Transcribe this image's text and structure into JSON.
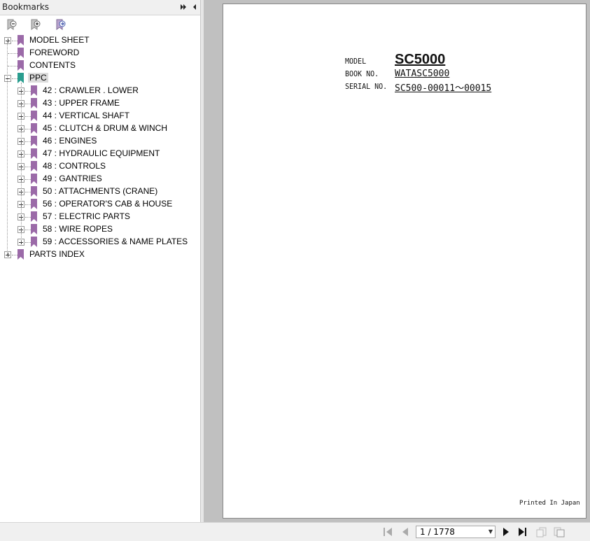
{
  "panel": {
    "title": "Bookmarks"
  },
  "tree": [
    {
      "label": "MODEL SHEET",
      "level": 0,
      "expander": "plus"
    },
    {
      "label": "FOREWORD",
      "level": 0,
      "expander": "none"
    },
    {
      "label": "CONTENTS",
      "level": 0,
      "expander": "none"
    },
    {
      "label": "PPC",
      "level": 0,
      "expander": "minus",
      "selected": true,
      "icon": "teal"
    },
    {
      "label": "42 : CRAWLER . LOWER",
      "level": 1,
      "expander": "plus"
    },
    {
      "label": "43 : UPPER FRAME",
      "level": 1,
      "expander": "plus"
    },
    {
      "label": "44 : VERTICAL SHAFT",
      "level": 1,
      "expander": "plus"
    },
    {
      "label": "45 : CLUTCH & DRUM & WINCH",
      "level": 1,
      "expander": "plus"
    },
    {
      "label": "46 : ENGINES",
      "level": 1,
      "expander": "plus"
    },
    {
      "label": "47 : HYDRAULIC EQUIPMENT",
      "level": 1,
      "expander": "plus"
    },
    {
      "label": "48 : CONTROLS",
      "level": 1,
      "expander": "plus"
    },
    {
      "label": "49 : GANTRIES",
      "level": 1,
      "expander": "plus"
    },
    {
      "label": "50 : ATTACHMENTS (CRANE)",
      "level": 1,
      "expander": "plus"
    },
    {
      "label": "56 : OPERATOR'S CAB & HOUSE",
      "level": 1,
      "expander": "plus"
    },
    {
      "label": "57 : ELECTRIC PARTS",
      "level": 1,
      "expander": "plus"
    },
    {
      "label": "58 : WIRE ROPES",
      "level": 1,
      "expander": "plus"
    },
    {
      "label": "59 : ACCESSORIES & NAME PLATES",
      "level": 1,
      "expander": "plus"
    },
    {
      "label": "PARTS INDEX",
      "level": 0,
      "expander": "plus"
    }
  ],
  "document": {
    "model_key": "MODEL",
    "model_value": "SC5000",
    "book_key": "BOOK NO.",
    "book_value": "WATASC5000",
    "serial_key": "SERIAL NO.",
    "serial_value": "SC500-00011～00015",
    "footer": "Printed In Japan"
  },
  "navigation": {
    "page_field": "1 / 1778"
  },
  "colors": {
    "bookmark": "#9b6aa8",
    "bookmark_selected": "#2a9d8f",
    "viewer_bg": "#c0c0c0"
  }
}
